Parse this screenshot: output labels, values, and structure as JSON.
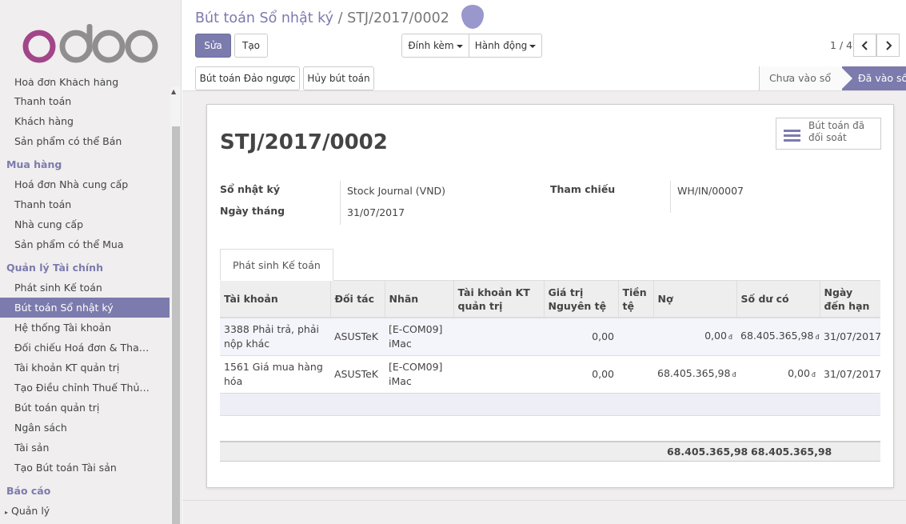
{
  "sidebar": {
    "items": [
      {
        "type": "item",
        "label": "Hoá đơn Khách hàng",
        "cut": true
      },
      {
        "type": "item",
        "label": "Thanh toán"
      },
      {
        "type": "item",
        "label": "Khách hàng"
      },
      {
        "type": "item",
        "label": "Sản phẩm có thể Bán"
      },
      {
        "type": "section",
        "label": "Mua hàng"
      },
      {
        "type": "item",
        "label": "Hoá đơn Nhà cung cấp"
      },
      {
        "type": "item",
        "label": "Thanh toán"
      },
      {
        "type": "item",
        "label": "Nhà cung cấp"
      },
      {
        "type": "item",
        "label": "Sản phẩm có thể Mua"
      },
      {
        "type": "section",
        "label": "Quản lý Tài chính"
      },
      {
        "type": "item",
        "label": "Phát sinh Kế toán"
      },
      {
        "type": "item",
        "label": "Bút toán Sổ nhật ký",
        "active": true
      },
      {
        "type": "item",
        "label": "Hệ thống Tài khoản"
      },
      {
        "type": "item",
        "label": "Đối chiếu Hoá đơn & Tha…"
      },
      {
        "type": "item",
        "label": "Tài khoản KT quản trị"
      },
      {
        "type": "item",
        "label": "Tạo Điều chỉnh Thuế Thủ…"
      },
      {
        "type": "item",
        "label": "Bút toán quản trị"
      },
      {
        "type": "item",
        "label": "Ngân sách"
      },
      {
        "type": "item",
        "label": "Tài sản"
      },
      {
        "type": "item",
        "label": "Tạo Bút toán Tài sản"
      },
      {
        "type": "section",
        "label": "Báo cáo"
      },
      {
        "type": "tree",
        "label": "Quản lý"
      }
    ]
  },
  "breadcrumb": {
    "parent": "Bút toán Sổ nhật ký",
    "separator": "/",
    "current": "STJ/2017/0002"
  },
  "toolbar": {
    "edit_label": "Sửa",
    "create_label": "Tạo",
    "attach_label": "Đính kèm",
    "action_label": "Hành động"
  },
  "pager": {
    "value": "1 / 4"
  },
  "buttons": {
    "reverse_label": "Bút toán Đảo ngược",
    "cancel_label": "Hủy bút toán"
  },
  "status": {
    "draft": "Chưa vào sổ",
    "posted": "Đã vào sổ"
  },
  "record": {
    "title": "STJ/2017/0002",
    "smart_button": "Bút toán đã đối soát",
    "journal_label": "Sổ nhật ký",
    "journal_value": "Stock Journal (VND)",
    "date_label": "Ngày tháng",
    "date_value": "31/07/2017",
    "ref_label": "Tham chiếu",
    "ref_value": "WH/IN/00007"
  },
  "tab": {
    "label": "Phát sinh Kế toán"
  },
  "lines": {
    "headers": [
      "Tài khoản",
      "Đối tác",
      "Nhãn",
      "Tài khoản KT quản trị",
      "Giá trị Nguyên tệ",
      "Tiền tệ",
      "Nợ",
      "Số dư có",
      "Ngày đến hạn"
    ],
    "rows": [
      {
        "account": "3388 Phải trả, phải nộp khác",
        "partner": "ASUSTeK",
        "label": "[E-COM09] iMac",
        "analytic": "",
        "amount_currency": "0,00",
        "currency": "",
        "debit": "0,00",
        "credit": "68.405.365,98",
        "due": "31/07/2017"
      },
      {
        "account": "1561 Giá mua hàng hóa",
        "partner": "ASUSTeK",
        "label": "[E-COM09] iMac",
        "analytic": "",
        "amount_currency": "0,00",
        "currency": "",
        "debit": "68.405.365,98",
        "credit": "0,00",
        "due": "31/07/2017"
      }
    ],
    "currency_symbol": "đ",
    "total_debit": "68.405.365,98",
    "total_credit": "68.405.365,98"
  },
  "colors": {
    "accent": "#7c7bad",
    "logo_o": "#a24689",
    "logo_text": "#8f8f8f"
  }
}
